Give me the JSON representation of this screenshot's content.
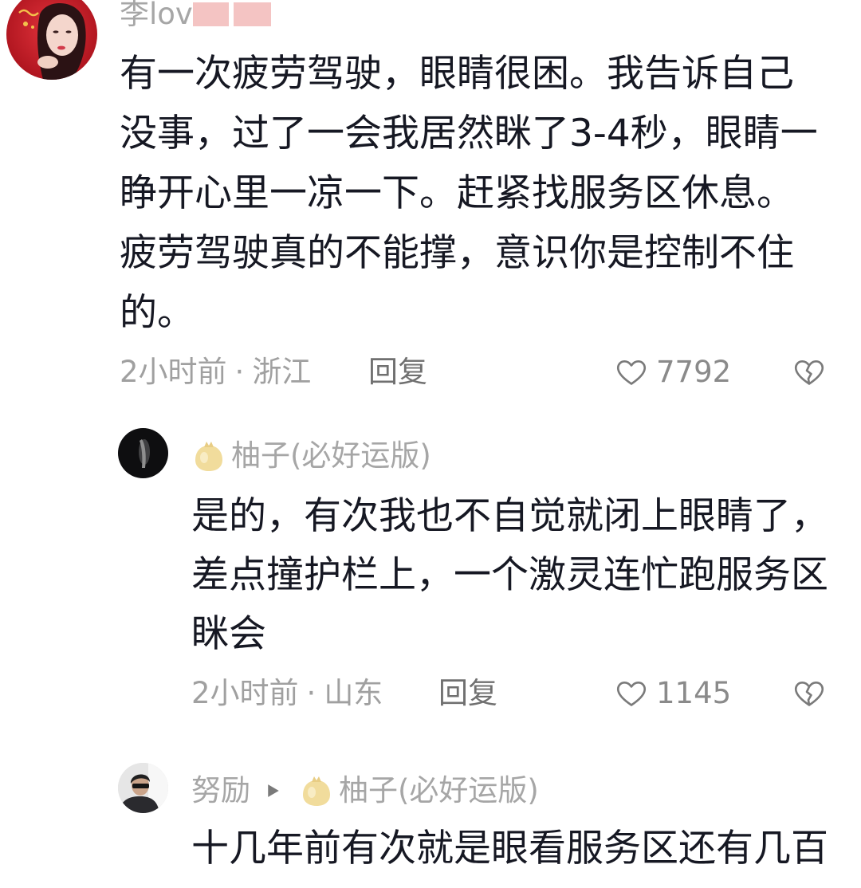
{
  "separator": "·",
  "icons": {
    "like": "heart-outline-icon",
    "dislike": "broken-heart-icon",
    "reply_to": "triangle-right-icon",
    "user_badge": "pomelo-badge-icon"
  },
  "colors": {
    "text": "#161823",
    "meta": "#a0a0a0",
    "username": "#a6a6a6",
    "reply": "#707070",
    "likes": "#8a8a8a",
    "icon": "#7a7a7a",
    "redaction": "#f4c4c3",
    "badge": "#f1dc9c"
  },
  "comment": {
    "username": "李lov",
    "text_lines": [
      "有一次疲劳驾驶，眼睛很困。我告诉自己",
      "没事，过了一会我居然眯了3-4秒，眼睛一",
      "睁开心里一凉一下。赶紧找服务区休息。",
      "疲劳驾驶真的不能撑，意识你是控制不住",
      "的。"
    ],
    "time": "2小时前",
    "location": "浙江",
    "reply_label": "回复",
    "likes": "7792"
  },
  "replies": [
    {
      "username": "柚子(必好运版)",
      "text_lines": [
        "是的，有次我也不自觉就闭上眼睛了，",
        "差点撞护栏上，一个激灵连忙跑服务区",
        "眯会"
      ],
      "time": "2小时前",
      "location": "山东",
      "reply_label": "回复",
      "likes": "1145"
    },
    {
      "username": "努励",
      "reply_to_username": "柚子(必好运版)",
      "text_lines": [
        "十几年前有次就是眼看服务区还有几百"
      ]
    }
  ]
}
